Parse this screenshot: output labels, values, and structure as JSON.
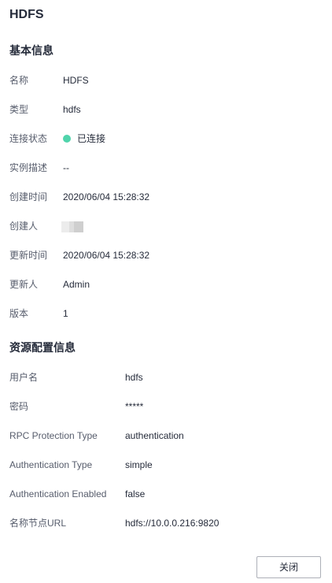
{
  "title": "HDFS",
  "basic_info": {
    "section_title": "基本信息",
    "name": {
      "label": "名称",
      "value": "HDFS"
    },
    "type": {
      "label": "类型",
      "value": "hdfs"
    },
    "connection_status": {
      "label": "连接状态",
      "value": "已连接",
      "color": "#50d4ab"
    },
    "description": {
      "label": "实例描述",
      "value": "--"
    },
    "created_time": {
      "label": "创建时间",
      "value": "2020/06/04 15:28:32"
    },
    "creator": {
      "label": "创建人"
    },
    "updated_time": {
      "label": "更新时间",
      "value": "2020/06/04 15:28:32"
    },
    "updater": {
      "label": "更新人",
      "value": "Admin"
    },
    "version": {
      "label": "版本",
      "value": "1"
    }
  },
  "resource_config": {
    "section_title": "资源配置信息",
    "username": {
      "label": "用户名",
      "value": "hdfs"
    },
    "password": {
      "label": "密码",
      "value": "*****"
    },
    "rpc_protection_type": {
      "label": "RPC Protection Type",
      "value": "authentication"
    },
    "authentication_type": {
      "label": "Authentication Type",
      "value": "simple"
    },
    "authentication_enabled": {
      "label": "Authentication Enabled",
      "value": "false"
    },
    "namenode_url": {
      "label": "名称节点URL",
      "value": "hdfs://10.0.0.216:9820"
    }
  },
  "footer": {
    "close_label": "关闭"
  },
  "colors": {
    "label": "#575d6c",
    "text": "#252b3a",
    "status_connected": "#50d4ab",
    "button_border": "#adb0b8"
  }
}
